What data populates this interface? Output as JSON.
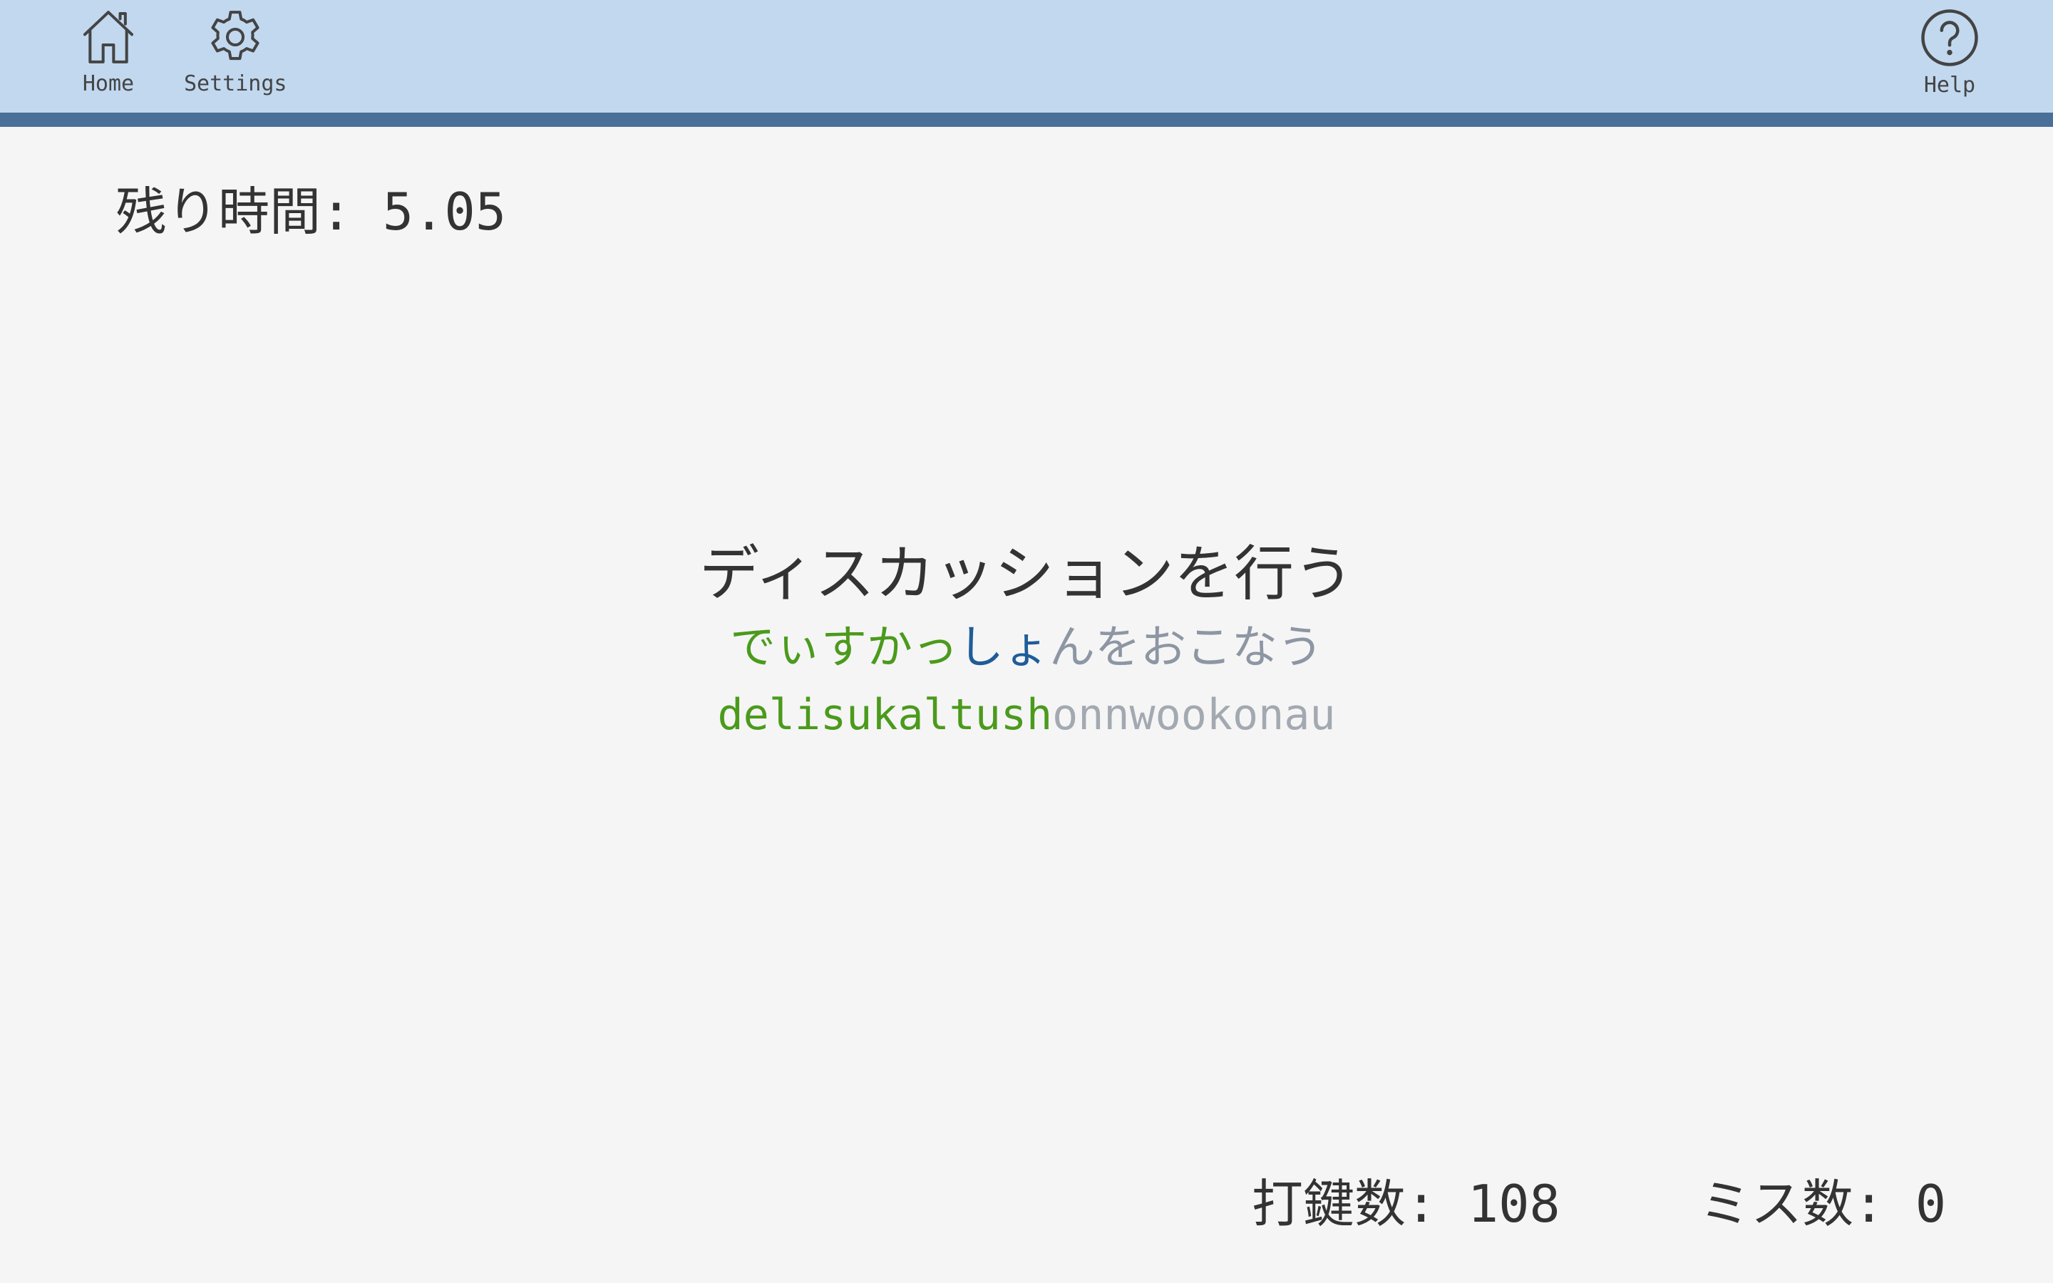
{
  "nav": {
    "home_label": "Home",
    "settings_label": "Settings",
    "help_label": "Help",
    "home_icon": "home-icon",
    "settings_icon": "gear-icon",
    "help_icon": "question-circle-icon"
  },
  "timer": {
    "label": "残り時間:",
    "value": "5.05"
  },
  "prompt": {
    "kanji": "ディスカッションを行う",
    "kana_typed": "でぃすかっ",
    "kana_current": "しょ",
    "kana_pending": "んをおこなう",
    "romaji_typed": "delisukaltush",
    "romaji_pending": "onnwookonau"
  },
  "stats": {
    "keystrokes_label": "打鍵数:",
    "keystrokes_value": "108",
    "misses_label": "ミス数:",
    "misses_value": "0"
  },
  "colors": {
    "header_bg": "#c1d8ef",
    "header_bar": "#4a6f98",
    "typed": "#4b9a1c",
    "current": "#1f5c99",
    "pending": "#8d96a3"
  }
}
